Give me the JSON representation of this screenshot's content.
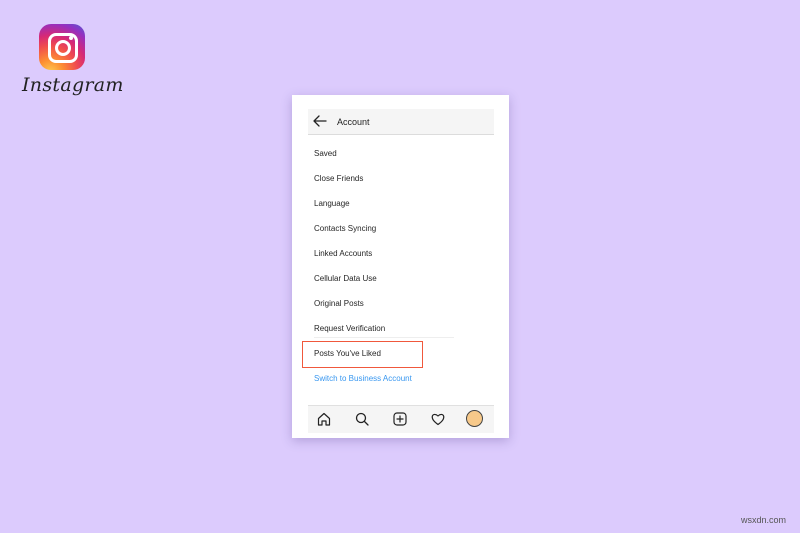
{
  "logo": {
    "text": "Instagram"
  },
  "header": {
    "title": "Account"
  },
  "menu": {
    "items": [
      {
        "label": "Saved"
      },
      {
        "label": "Close Friends"
      },
      {
        "label": "Language"
      },
      {
        "label": "Contacts Syncing"
      },
      {
        "label": "Linked Accounts"
      },
      {
        "label": "Cellular Data Use"
      },
      {
        "label": "Original Posts"
      },
      {
        "label": "Request Verification"
      },
      {
        "label": "Posts You've Liked"
      },
      {
        "label": "Switch to Business Account"
      }
    ]
  },
  "bottom_nav": {
    "icons": [
      "home-icon",
      "search-icon",
      "add-post-icon",
      "heart-icon",
      "profile-avatar"
    ]
  },
  "watermark": {
    "text": "wsxdn.com"
  },
  "colors": {
    "background": "#dccbfd",
    "highlight": "#f0583c",
    "link": "#3897f0"
  }
}
